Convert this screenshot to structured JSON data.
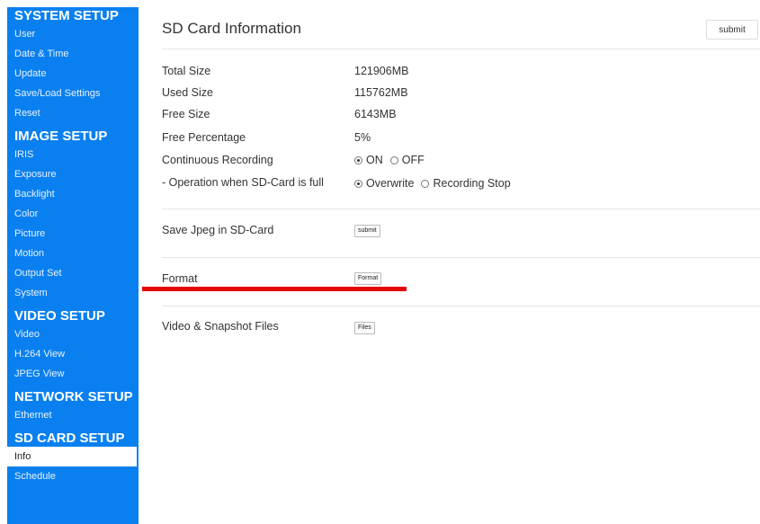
{
  "sidebar": {
    "sections": [
      {
        "title": "SYSTEM SETUP",
        "items": [
          "User",
          "Date & Time",
          "Update",
          "Save/Load Settings",
          "Reset"
        ]
      },
      {
        "title": "IMAGE SETUP",
        "items": [
          "IRIS",
          "Exposure",
          "Backlight",
          "Color",
          "Picture",
          "Motion",
          "Output Set",
          "System"
        ]
      },
      {
        "title": "VIDEO SETUP",
        "items": [
          "Video",
          "H.264 View",
          "JPEG View"
        ]
      },
      {
        "title": "NETWORK SETUP",
        "items": [
          "Ethernet"
        ]
      },
      {
        "title": "SD CARD SETUP",
        "items": [
          "Info",
          "Schedule"
        ]
      }
    ],
    "active_item": "Info"
  },
  "main": {
    "title": "SD Card Information",
    "submit_label": "submit",
    "info": [
      {
        "label": "Total Size",
        "value": "121906MB"
      },
      {
        "label": "Used Size",
        "value": "115762MB"
      },
      {
        "label": "Free Size",
        "value": "6143MB"
      },
      {
        "label": "Free Percentage",
        "value": "5%"
      }
    ],
    "continuous_recording": {
      "label": "Continuous Recording",
      "options": [
        "ON",
        "OFF"
      ],
      "selected": "ON"
    },
    "operation_full": {
      "label": "- Operation when SD-Card is full",
      "options": [
        "Overwrite",
        "Recording Stop"
      ],
      "selected": "Overwrite"
    },
    "save_jpeg": {
      "label": "Save Jpeg in SD-Card",
      "button": "submit"
    },
    "format": {
      "label": "Format",
      "button": "Format"
    },
    "files": {
      "label": "Video & Snapshot Files",
      "button": "Files"
    }
  },
  "colors": {
    "sidebar": "#0a80f0",
    "highlight": "#e60000"
  }
}
